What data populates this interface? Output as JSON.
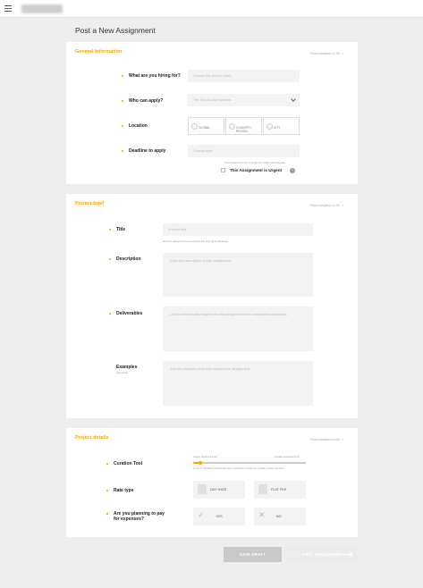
{
  "header": {
    "page_title": "Post a New Assignment"
  },
  "general": {
    "title": "General Information",
    "hint": "Fields navigation to 3/5",
    "hiring_label": "What are you hiring for?",
    "hiring_placeholder": "Choose the service need...",
    "who_label": "Who can apply?",
    "who_value": "The Storyfunder Network",
    "location_label": "Location",
    "loc_global": "GLOBAL",
    "loc_country": "COUNTRY / REGION",
    "loc_city": "CITY",
    "deadline_label": "Deadline to apply",
    "deadline_placeholder": "Choose date",
    "deadline_note": "Your assignment will no longer be visible after this date",
    "urgent_label": "This Assignment is Urgent",
    "help": "?"
  },
  "brief": {
    "title": "Project brief",
    "hint": "Fields navigation to 4/5",
    "title_label": "Title",
    "title_placeholder": "Entered text",
    "title_note": "Give the assignment a descriptive title that will be attractive",
    "desc_label": "Description",
    "desc_placeholder": "Enter the description of your assignment",
    "deliv_label": "Deliverables",
    "deliv_placeholder": "List the deliverables required for this assignment to be completed successfully",
    "examples_label": "Examples",
    "examples_sub": "(optional)",
    "examples_placeholder": "Add any examples that help explain your assignment"
  },
  "details": {
    "title": "Project details",
    "hint": "Fields navigation to 5/5",
    "curation_label": "Curation Tool",
    "curation_left": "Larger Applicant Pool",
    "curation_right": "Smaller Applicant Pool",
    "curation_note": "Level 1 - Verified professional work experience confirmed. Quality review required.",
    "curation_level": 0.06,
    "rate_label": "Rate type",
    "rate_day": "DAY RATE",
    "rate_flat": "FLAT FEE",
    "expenses_label": "Are you planning to pay for expenses?",
    "yes": "YES",
    "no": "NO"
  },
  "actions": {
    "save": "SAVE DRAFT",
    "post": "POST ASSIGNMENT"
  },
  "colors": {
    "accent": "#f2a900",
    "arrow": "#e58a00"
  }
}
